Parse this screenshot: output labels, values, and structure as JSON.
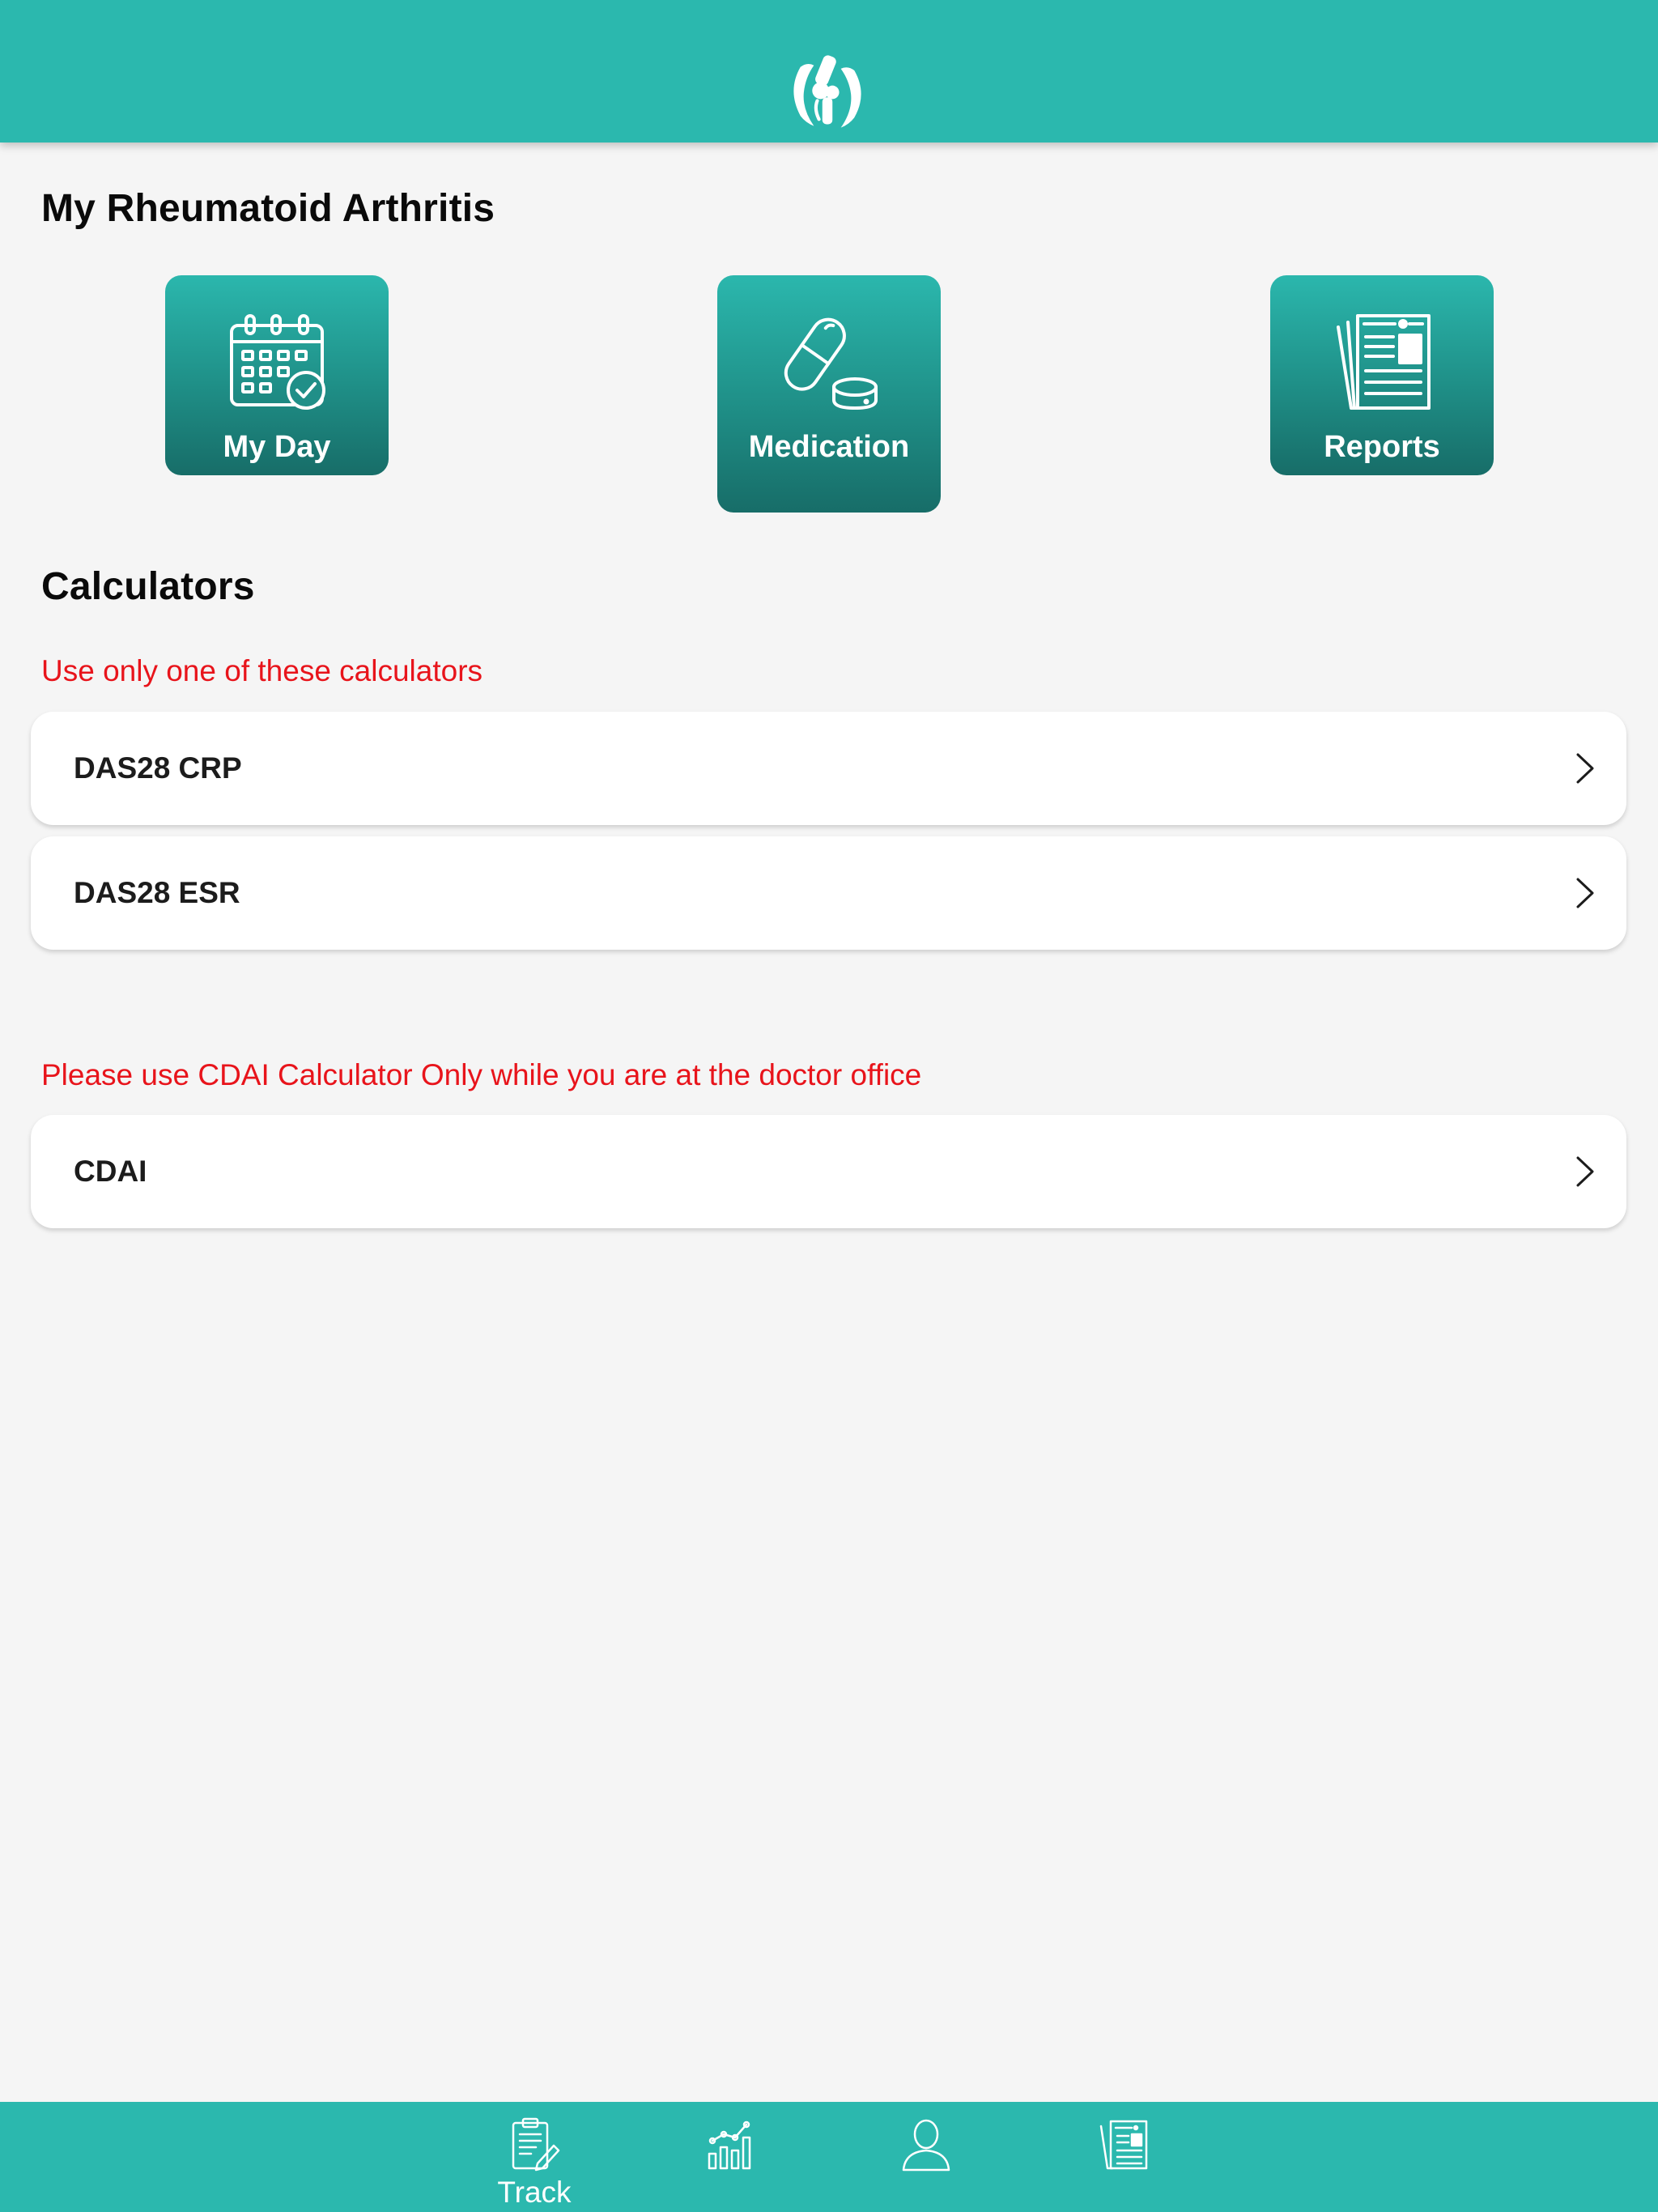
{
  "header": {
    "logo_icon": "knee-joint-logo-icon"
  },
  "section_ra": {
    "title": "My Rheumatoid Arthritis",
    "tiles": [
      {
        "label": "My Day",
        "icon": "calendar-check-icon"
      },
      {
        "label": "Medication",
        "icon": "pill-capsule-icon"
      },
      {
        "label": "Reports",
        "icon": "documents-icon"
      }
    ]
  },
  "calculators": {
    "title": "Calculators",
    "note_one": "Use only one of these calculators",
    "items": [
      {
        "label": "DAS28 CRP"
      },
      {
        "label": "DAS28 ESR"
      }
    ],
    "note_cdai": "Please use CDAI Calculator Only while you are at the doctor office",
    "cdai": {
      "label": "CDAI"
    }
  },
  "tabbar": {
    "tabs": [
      {
        "label": "Track",
        "icon": "clipboard-pencil-icon"
      },
      {
        "label": "",
        "icon": "chart-icon"
      },
      {
        "label": "",
        "icon": "user-icon"
      },
      {
        "label": "",
        "icon": "news-icon"
      }
    ]
  },
  "colors": {
    "brand_teal": "#2bb8ae",
    "tile_dark": "#176d68",
    "alert_red": "#e8141b",
    "background": "#f5f5f5"
  }
}
